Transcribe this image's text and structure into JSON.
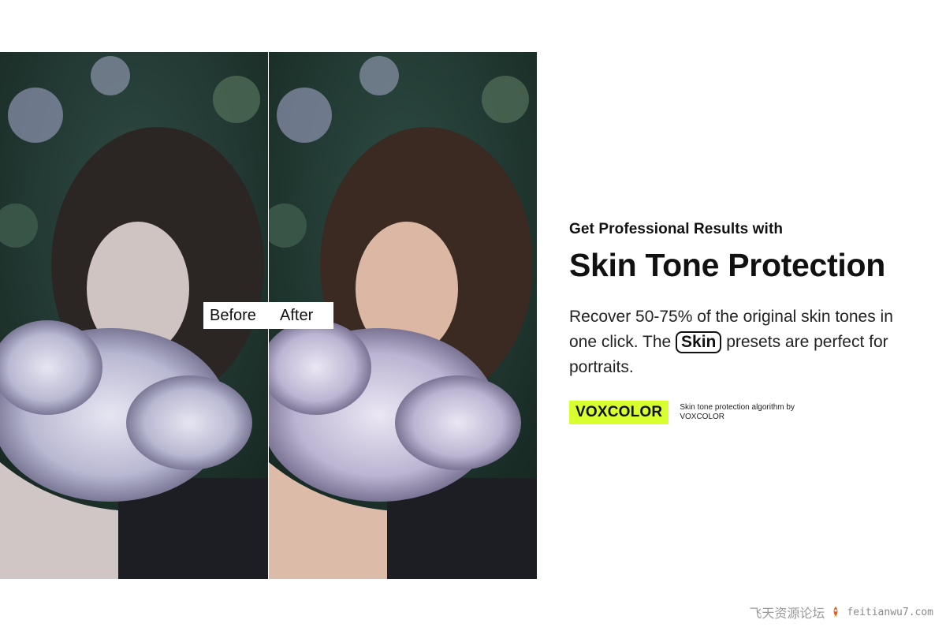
{
  "photos": {
    "before_label": "Before",
    "after_label": "After"
  },
  "copy": {
    "eyebrow": "Get Professional Results with",
    "headline": "Skin Tone Protection",
    "body_part1": "Recover 50-75% of the original skin tones in one click.  The ",
    "body_pill": "Skin",
    "body_part2": " presets are perfect for portraits."
  },
  "brand": {
    "badge": "VOXCOLOR",
    "note": "Skin tone protection algorithm by VOXCOLOR",
    "accent_color": "#d8ff2e"
  },
  "watermark": {
    "site_name": "飞天资源论坛",
    "url": "feitianwu7.com"
  }
}
